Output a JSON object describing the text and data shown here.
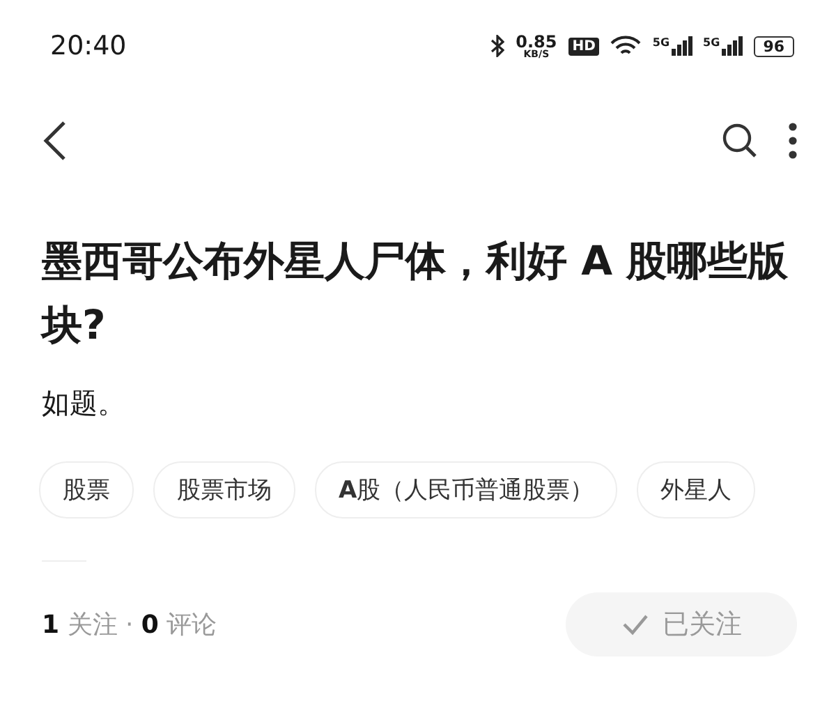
{
  "status_bar": {
    "time": "20:40",
    "net_speed": "0.85",
    "net_unit": "KB/S",
    "hd": "HD",
    "sim_1": "5G",
    "sim_2": "5G",
    "battery": "96"
  },
  "question": {
    "title": "墨西哥公布外星人尸体，利好 A 股哪些版块?",
    "body": "如题。"
  },
  "topics": [
    "股票",
    "股票市场",
    "**A**股（人民币普通股票）",
    "外星人"
  ],
  "stats": "**1** 关注 · **0** 评论",
  "follow_button": {
    "label": "已关注",
    "followed": true
  }
}
